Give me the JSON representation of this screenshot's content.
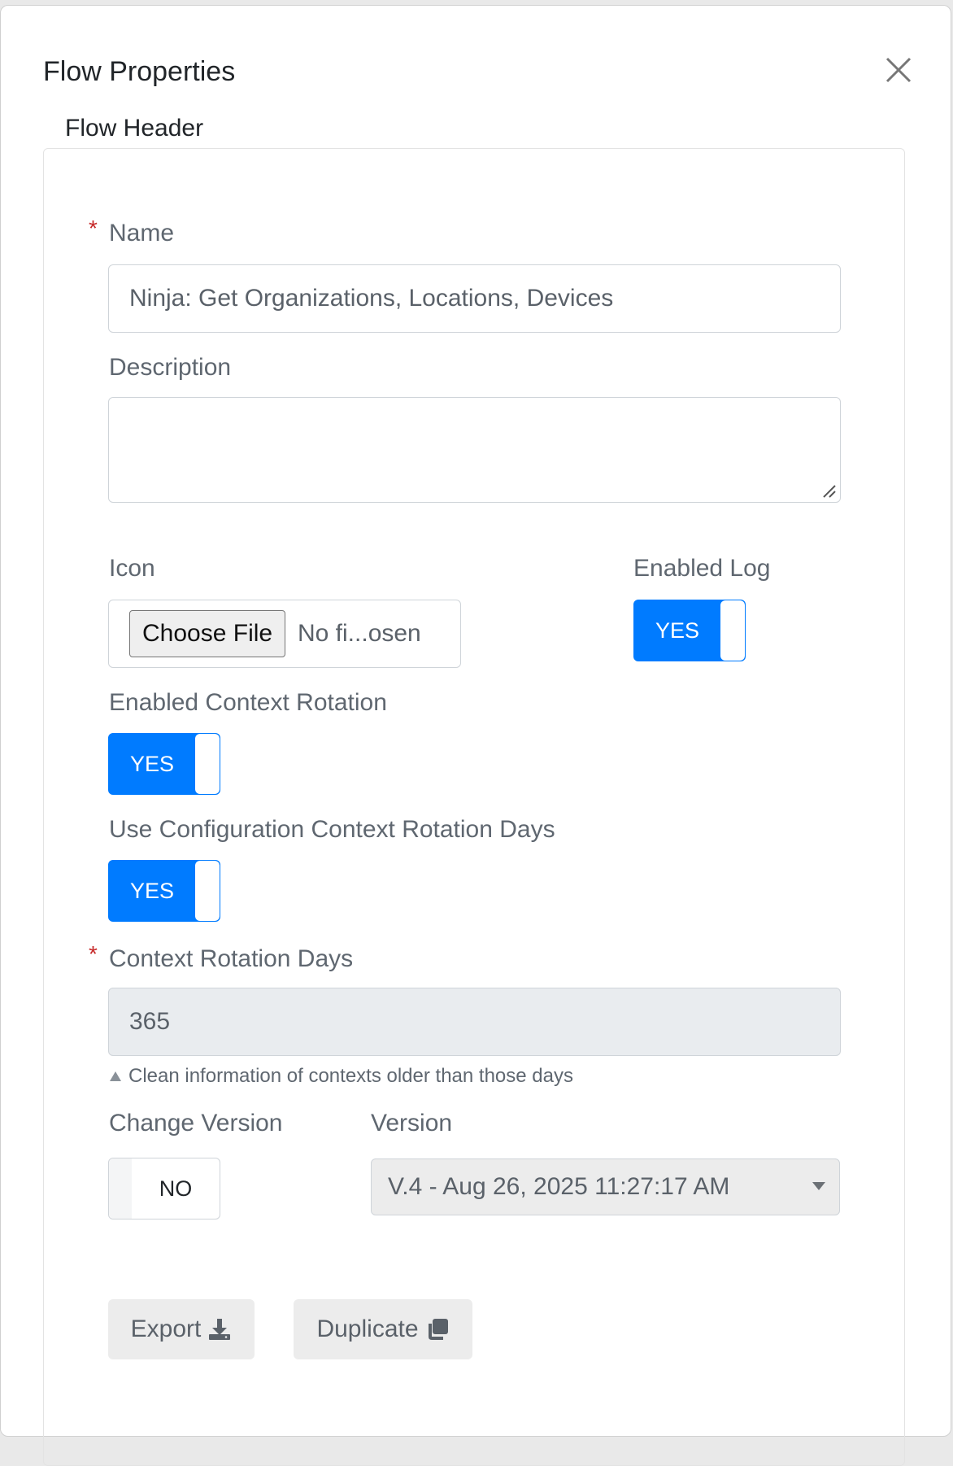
{
  "dialog": {
    "title": "Flow Properties",
    "section_legend": "Flow Header"
  },
  "form": {
    "name": {
      "label": "Name",
      "required_mark": "*",
      "value": "Ninja: Get Organizations, Locations, Devices"
    },
    "description": {
      "label": "Description",
      "value": ""
    },
    "icon": {
      "label": "Icon",
      "button_label": "Choose File",
      "file_name": "No fi...osen"
    },
    "enabled_log": {
      "label": "Enabled Log",
      "state_label": "YES"
    },
    "enabled_context_rotation": {
      "label": "Enabled Context Rotation",
      "state_label": "YES"
    },
    "use_config_rotation_days": {
      "label": "Use Configuration Context Rotation Days",
      "state_label": "YES"
    },
    "context_rotation_days": {
      "label": "Context Rotation Days",
      "required_mark": "*",
      "value": "365",
      "hint": "Clean information of contexts older than those days"
    },
    "change_version": {
      "label": "Change Version",
      "state_label": "NO"
    },
    "version": {
      "label": "Version",
      "selected": "V.4 - Aug 26, 2025 11:27:17 AM"
    }
  },
  "actions": {
    "export_label": "Export",
    "duplicate_label": "Duplicate"
  },
  "colors": {
    "accent": "#007bff",
    "required": "#c62828"
  }
}
